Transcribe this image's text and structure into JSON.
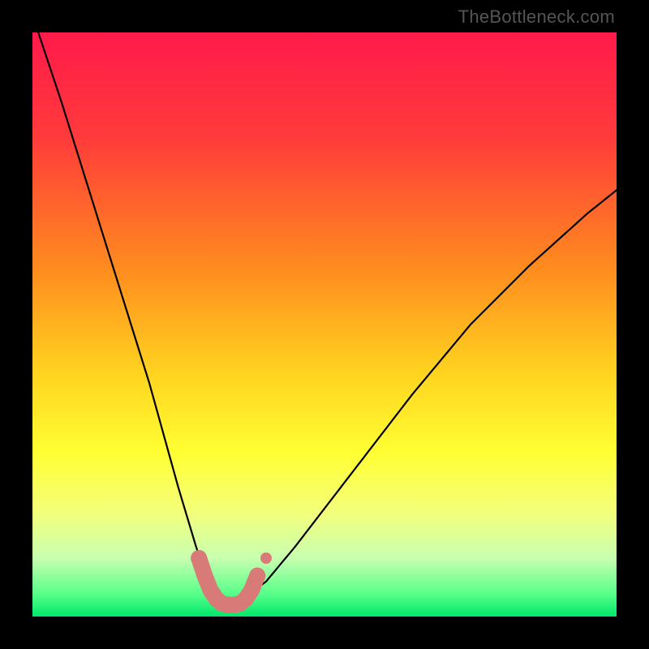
{
  "attribution": "TheBottleneck.com",
  "chart_data": {
    "type": "line",
    "title": "",
    "xlabel": "",
    "ylabel": "",
    "xlim": [
      0,
      100
    ],
    "ylim": [
      0,
      100
    ],
    "gradient_stops": [
      {
        "offset": 0,
        "color": "#ff1a4a"
      },
      {
        "offset": 18,
        "color": "#ff3b3b"
      },
      {
        "offset": 40,
        "color": "#ff8a1f"
      },
      {
        "offset": 58,
        "color": "#ffd21f"
      },
      {
        "offset": 72,
        "color": "#ffff33"
      },
      {
        "offset": 82,
        "color": "#f4ff7a"
      },
      {
        "offset": 90,
        "color": "#c8ffb0"
      },
      {
        "offset": 96,
        "color": "#5aff8a"
      },
      {
        "offset": 100,
        "color": "#00e86b"
      }
    ],
    "series": [
      {
        "name": "bottleneck-curve",
        "x": [
          1,
          5,
          10,
          15,
          20,
          25,
          28,
          30,
          32,
          34,
          36,
          40,
          45,
          55,
          65,
          75,
          85,
          95,
          100
        ],
        "y": [
          100,
          88,
          72,
          56,
          40,
          22,
          12,
          6,
          3,
          2,
          3,
          6,
          12,
          25,
          38,
          50,
          60,
          69,
          73
        ]
      }
    ],
    "markers": {
      "name": "highlight-segment",
      "color": "#d87a78",
      "x": [
        28.5,
        29.5,
        30.5,
        31.5,
        32.5,
        33.5,
        34.5,
        35.5,
        36.5,
        37.5,
        38.5
      ],
      "y": [
        10,
        7,
        4.5,
        3,
        2.2,
        2,
        2,
        2.2,
        3,
        4.5,
        7
      ]
    }
  }
}
